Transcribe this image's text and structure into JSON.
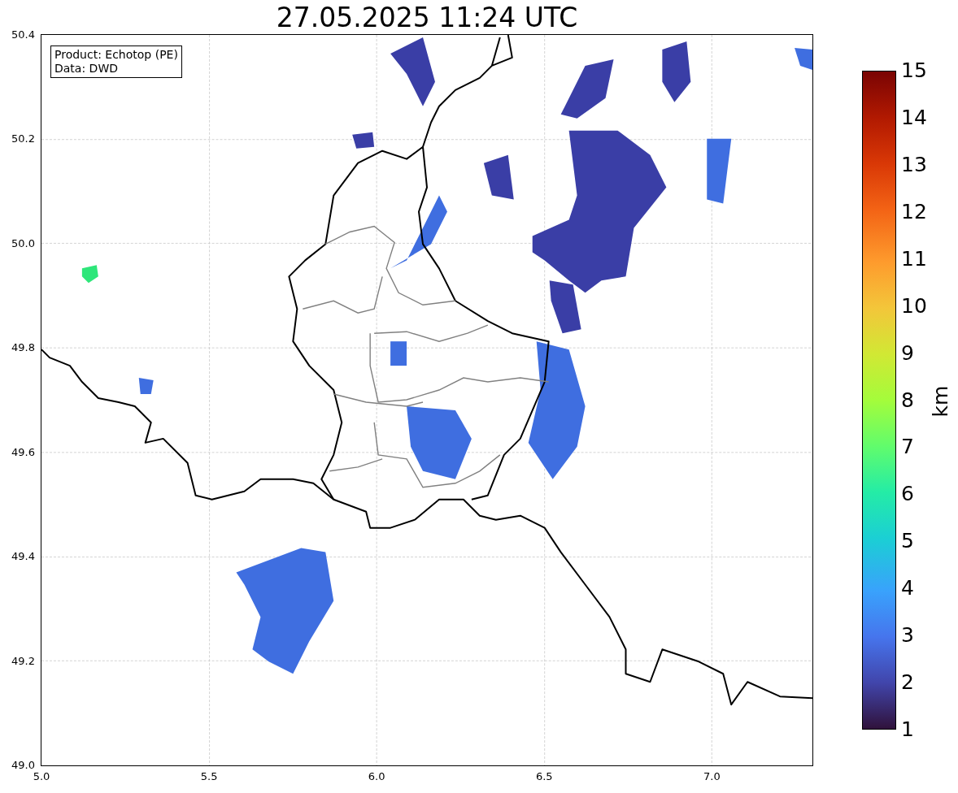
{
  "title": "27.05.2025 11:24 UTC",
  "legend": [
    "Product: Echotop (PE)",
    "Data: DWD"
  ],
  "x_axis": {
    "ticks": [
      "5.0",
      "5.5",
      "6.0",
      "6.5",
      "7.0"
    ]
  },
  "y_axis": {
    "ticks": [
      "50.4",
      "50.2",
      "50.0",
      "49.8",
      "49.6",
      "49.4",
      "49.2",
      "49.0"
    ]
  },
  "colorbar": {
    "label": "km",
    "ticks": [
      "15",
      "14",
      "13",
      "12",
      "11",
      "10",
      "9",
      "8",
      "7",
      "6",
      "5",
      "4",
      "3",
      "2",
      "1"
    ]
  }
}
